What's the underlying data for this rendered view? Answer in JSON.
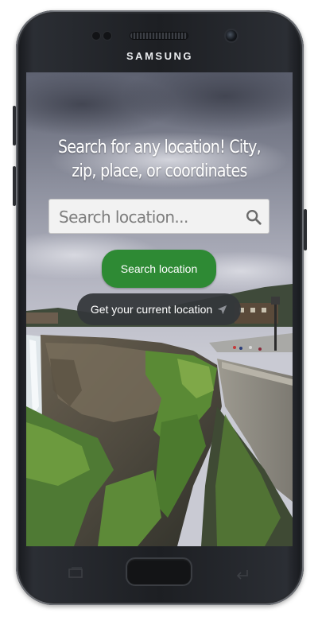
{
  "device": {
    "brand": "SAMSUNG"
  },
  "screen": {
    "headline": "Search for any location! City, zip, place, or coordinates",
    "search": {
      "placeholder": "Search location..."
    },
    "search_button_label": "Search location",
    "locate_button_label": "Get your current location"
  },
  "icons": {
    "search": "magnifier-icon",
    "locate": "navigation-arrow-icon",
    "recents": "recent-apps-icon",
    "back": "back-arrow-icon"
  },
  "colors": {
    "search_button": "#2e8a34",
    "locate_button": "#34373a",
    "headline_text": "#ffffff"
  }
}
